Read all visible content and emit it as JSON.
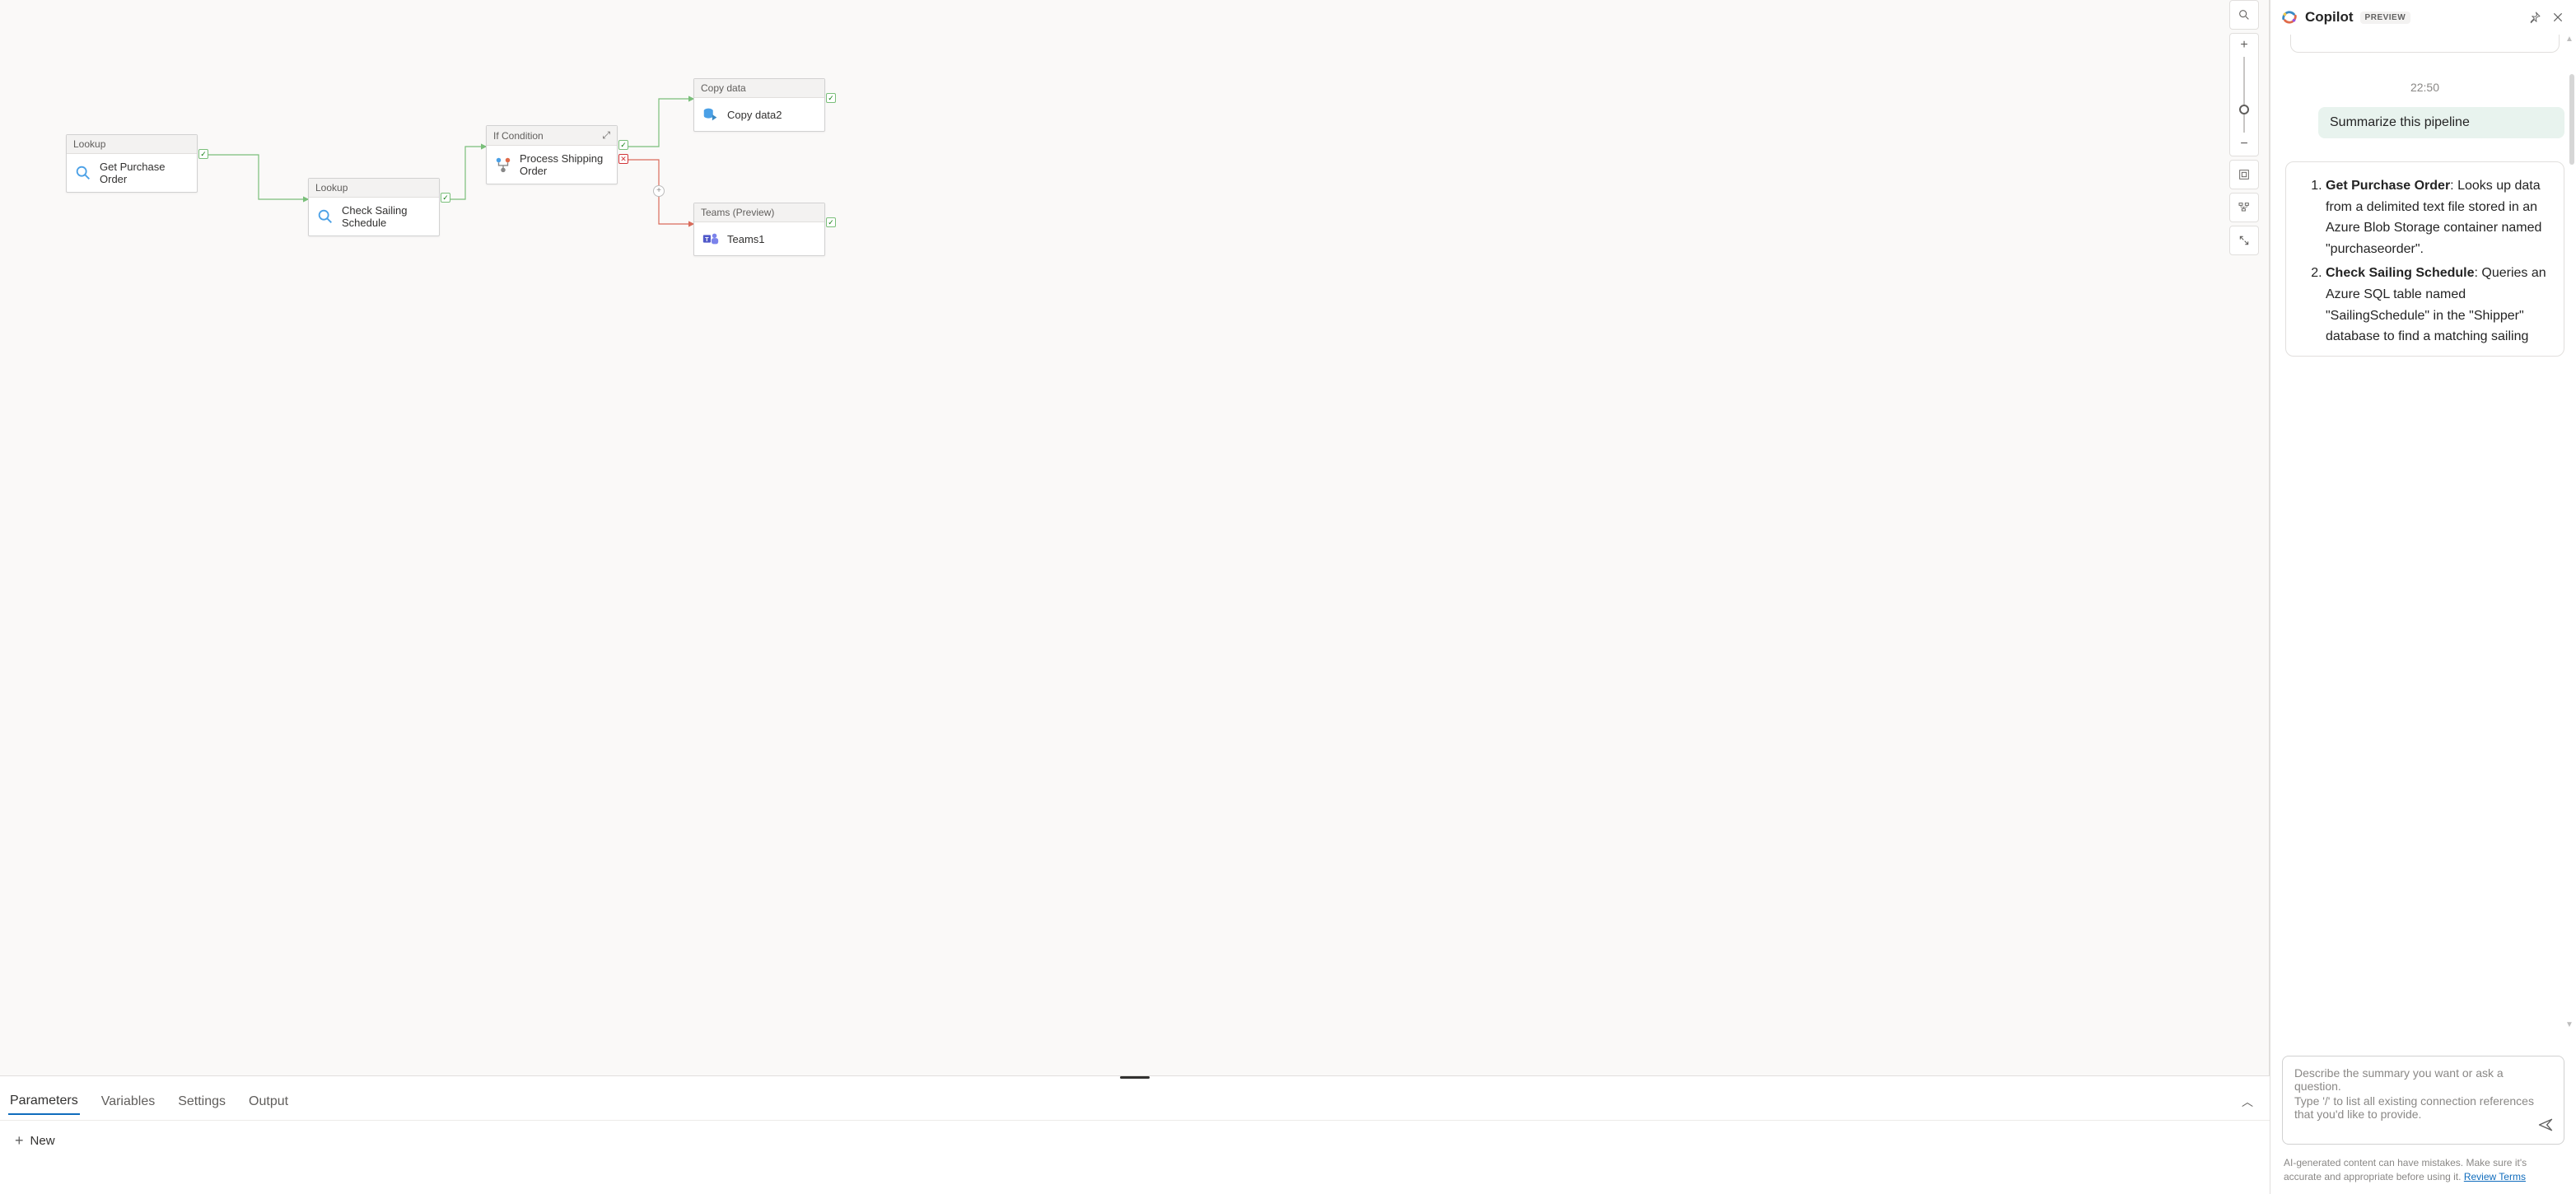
{
  "canvas": {
    "nodes": {
      "n1": {
        "type": "Lookup",
        "label": "Get Purchase Order"
      },
      "n2": {
        "type": "Lookup",
        "label": "Check Sailing Schedule"
      },
      "n3": {
        "type": "If Condition",
        "label": "Process Shipping Order"
      },
      "n4": {
        "type": "Copy data",
        "label": "Copy data2"
      },
      "n5": {
        "type": "Teams (Preview)",
        "label": "Teams1"
      }
    }
  },
  "bottomPanel": {
    "tabs": [
      "Parameters",
      "Variables",
      "Settings",
      "Output"
    ],
    "activeTab": 0,
    "newLabel": "New"
  },
  "copilot": {
    "title": "Copilot",
    "badge": "PREVIEW",
    "timestamp": "22:50",
    "userPrompt": "Summarize this pipeline",
    "response": {
      "items": [
        {
          "title": "Get Purchase Order",
          "body": ": Looks up data from a delimited text file stored in an Azure Blob Storage container named \"purchaseorder\"."
        },
        {
          "title": "Check Sailing Schedule",
          "body": ": Queries an Azure SQL table named \"SailingSchedule\" in the \"Shipper\" database to find a matching sailing"
        }
      ]
    },
    "input": {
      "placeholder1": "Describe the summary you want or ask a question.",
      "placeholder2": "Type '/' to list all existing connection references that you'd like to provide."
    },
    "footer": {
      "text": "AI-generated content can have mistakes. Make sure it's accurate and appropriate before using it. ",
      "link": "Review Terms"
    }
  }
}
